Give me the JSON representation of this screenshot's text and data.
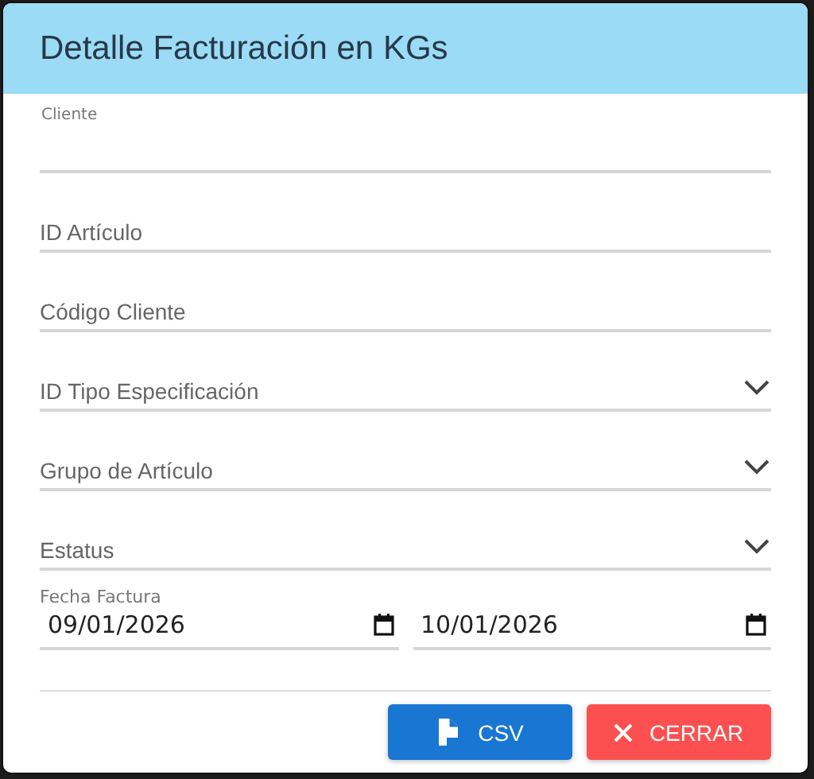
{
  "dialog": {
    "title": "Detalle Facturación en KGs"
  },
  "fields": [
    {
      "kind": "text",
      "label": "Cliente"
    },
    {
      "kind": "text",
      "placeholder": "ID Artículo"
    },
    {
      "kind": "text",
      "placeholder": "Código Cliente"
    },
    {
      "kind": "select",
      "placeholder": "ID Tipo Especificación"
    },
    {
      "kind": "select",
      "placeholder": "Grupo de Artículo"
    },
    {
      "kind": "select",
      "placeholder": "Estatus"
    }
  ],
  "date_range": {
    "label": "Fecha Factura",
    "from": "09/01/2026",
    "to": "10/01/2026"
  },
  "buttons": [
    {
      "kind": "csv",
      "label": "CSV"
    },
    {
      "kind": "close",
      "label": "CERRAR"
    }
  ]
}
